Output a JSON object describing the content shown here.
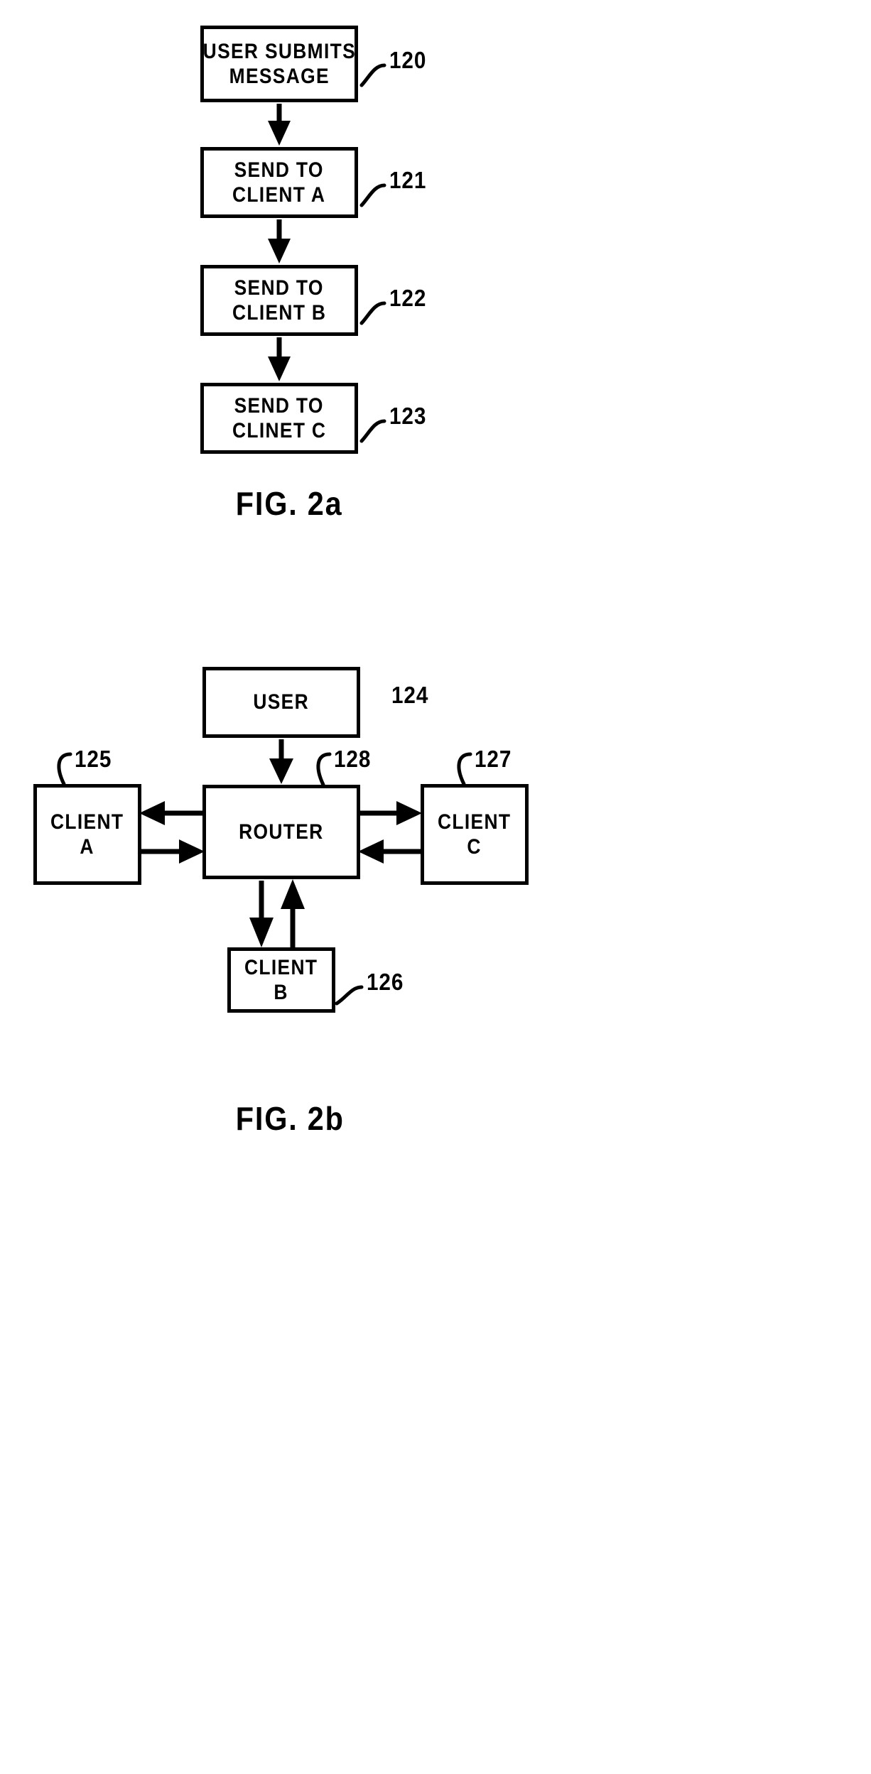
{
  "document": {
    "kind": "patent-drawing-sheet",
    "background_color": "#ffffff",
    "ink_color": "#000000"
  },
  "figures": [
    {
      "id": "fig-2a",
      "caption": "FIG.  2a",
      "type": "flowchart",
      "nodes": [
        {
          "ref": "120",
          "lines": [
            "USER SUBMITS",
            "MESSAGE"
          ]
        },
        {
          "ref": "121",
          "lines": [
            "SEND TO",
            "CLIENT A"
          ]
        },
        {
          "ref": "122",
          "lines": [
            "SEND TO",
            "CLIENT B"
          ]
        },
        {
          "ref": "123",
          "lines": [
            "SEND TO",
            "CLINET C"
          ]
        }
      ],
      "flow": [
        "120",
        "121",
        "122",
        "123"
      ]
    },
    {
      "id": "fig-2b",
      "caption": "FIG.  2b",
      "type": "block-diagram",
      "nodes": [
        {
          "ref": "124",
          "lines": [
            "USER"
          ]
        },
        {
          "ref": "125",
          "lines": [
            "CLIENT",
            "A"
          ]
        },
        {
          "ref": "128",
          "lines": [
            "ROUTER"
          ]
        },
        {
          "ref": "127",
          "lines": [
            "CLIENT",
            "C"
          ]
        },
        {
          "ref": "126",
          "lines": [
            "CLIENT",
            "B"
          ]
        }
      ],
      "connections": [
        {
          "from": "124",
          "to": "128",
          "direction": "one-way"
        },
        {
          "from": "128",
          "to": "125",
          "direction": "one-way"
        },
        {
          "from": "125",
          "to": "128",
          "direction": "one-way"
        },
        {
          "from": "128",
          "to": "127",
          "direction": "one-way"
        },
        {
          "from": "127",
          "to": "128",
          "direction": "one-way"
        },
        {
          "from": "128",
          "to": "126",
          "direction": "one-way"
        },
        {
          "from": "126",
          "to": "128",
          "direction": "one-way"
        }
      ]
    }
  ],
  "fig2a": {
    "box120": {
      "l1": "USER SUBMITS",
      "l2": "MESSAGE",
      "ref": "120"
    },
    "box121": {
      "l1": "SEND TO",
      "l2": "CLIENT A",
      "ref": "121"
    },
    "box122": {
      "l1": "SEND TO",
      "l2": "CLIENT B",
      "ref": "122"
    },
    "box123": {
      "l1": "SEND TO",
      "l2": "CLINET C",
      "ref": "123"
    },
    "caption": "FIG.  2a"
  },
  "fig2b": {
    "user": {
      "l1": "USER",
      "ref": "124"
    },
    "clientA": {
      "l1": "CLIENT",
      "l2": "A",
      "ref": "125"
    },
    "router": {
      "l1": "ROUTER",
      "ref": "128"
    },
    "clientC": {
      "l1": "CLIENT",
      "l2": "C",
      "ref": "127"
    },
    "clientB": {
      "l1": "CLIENT",
      "l2": "B",
      "ref": "126"
    },
    "caption": "FIG.  2b"
  }
}
